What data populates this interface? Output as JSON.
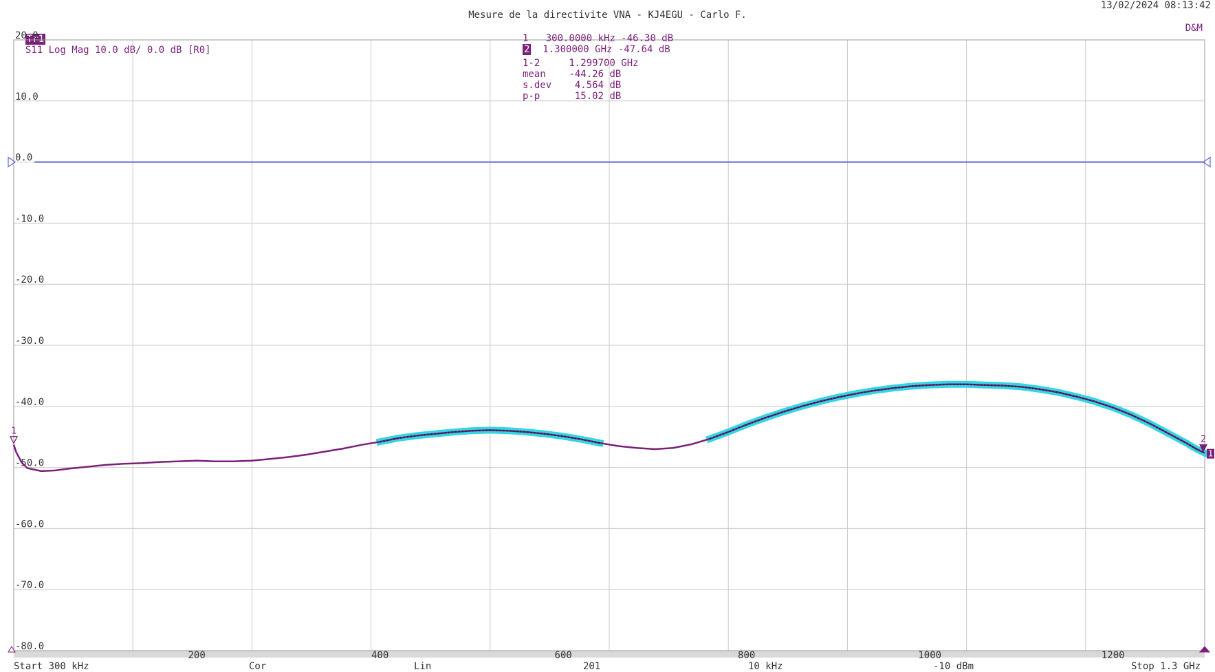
{
  "header": {
    "title": "Mesure de la directivite VNA - KJ4EGU - Carlo F.",
    "datetime": "13/02/2024 08:13:42",
    "trace_badge": "Tr1",
    "trace_info": "S11 Log Mag 10.0 dB/ 0.0 dB [R0]",
    "corner_label": "D&M"
  },
  "marker_table": {
    "m1_id": "1",
    "m1_value": "300.0000 kHz -46.30 dB",
    "m2_id": "2",
    "m2_value": "1.300000 GHz -47.64 dB",
    "delta_label": "1-2",
    "delta_value": "1.299700 GHz",
    "mean_label": "mean",
    "mean_value": "-44.26 dB",
    "sdev_label": "s.dev",
    "sdev_value": "4.564 dB",
    "pp_label": "p-p",
    "pp_value": "15.02 dB"
  },
  "footer": {
    "start": "Start 300 kHz",
    "cor": "Cor",
    "lin": "Lin",
    "points": "201",
    "ifbw": "10 kHz",
    "power": "-10 dBm",
    "stop": "Stop 1.3 GHz"
  },
  "colors": {
    "trace": "#7a1f7a",
    "highlight": "#33d6e6",
    "reference": "#5a66d9",
    "grid": "#c8c8c8",
    "bottom_bar": "#d9d9d9"
  },
  "chart_data": {
    "type": "line",
    "title": "Mesure de la directivite VNA - KJ4EGU - Carlo F.",
    "xlabel": "",
    "ylabel": "",
    "xlim": [
      0.3,
      1300
    ],
    "ylim": [
      -80,
      20
    ],
    "x_unit": "MHz",
    "y_unit": "dB",
    "yticks": [
      20,
      10,
      0,
      -10,
      -20,
      -30,
      -40,
      -50,
      -60,
      -70,
      -80
    ],
    "ytick_labels": [
      "20.0",
      "10.0",
      "0.0",
      "-10.0",
      "-20.0",
      "-30.0",
      "-40.0",
      "-50.0",
      "-60.0",
      "-70.0",
      "-80.0"
    ],
    "xticks": [
      200,
      400,
      600,
      800,
      1000,
      1200
    ],
    "xtick_labels": [
      "200",
      "400",
      "600",
      "800",
      "1000",
      "1200"
    ],
    "grid": true,
    "reference_level": 0.0,
    "series": [
      {
        "points": [
          [
            0.3,
            -46.3
          ],
          [
            3,
            -47.5
          ],
          [
            9,
            -49.2
          ],
          [
            15,
            -50.1
          ],
          [
            30,
            -50.6
          ],
          [
            45,
            -50.5
          ],
          [
            60,
            -50.2
          ],
          [
            80,
            -49.9
          ],
          [
            100,
            -49.6
          ],
          [
            120,
            -49.4
          ],
          [
            140,
            -49.3
          ],
          [
            160,
            -49.1
          ],
          [
            180,
            -49.0
          ],
          [
            200,
            -48.9
          ],
          [
            220,
            -49.0
          ],
          [
            240,
            -49.0
          ],
          [
            260,
            -48.9
          ],
          [
            280,
            -48.6
          ],
          [
            300,
            -48.3
          ],
          [
            320,
            -47.9
          ],
          [
            340,
            -47.4
          ],
          [
            360,
            -46.9
          ],
          [
            380,
            -46.3
          ],
          [
            400,
            -45.8
          ],
          [
            420,
            -45.2
          ],
          [
            440,
            -44.8
          ],
          [
            460,
            -44.5
          ],
          [
            480,
            -44.2
          ],
          [
            500,
            -44.0
          ],
          [
            520,
            -43.9
          ],
          [
            540,
            -44.0
          ],
          [
            560,
            -44.2
          ],
          [
            580,
            -44.5
          ],
          [
            600,
            -44.9
          ],
          [
            620,
            -45.4
          ],
          [
            640,
            -46.0
          ],
          [
            660,
            -46.5
          ],
          [
            680,
            -46.8
          ],
          [
            700,
            -47.0
          ],
          [
            720,
            -46.8
          ],
          [
            740,
            -46.2
          ],
          [
            760,
            -45.3
          ],
          [
            780,
            -44.2
          ],
          [
            800,
            -43.0
          ],
          [
            820,
            -41.9
          ],
          [
            840,
            -40.9
          ],
          [
            860,
            -40.0
          ],
          [
            880,
            -39.2
          ],
          [
            900,
            -38.5
          ],
          [
            920,
            -37.9
          ],
          [
            940,
            -37.4
          ],
          [
            960,
            -37.0
          ],
          [
            980,
            -36.7
          ],
          [
            1000,
            -36.5
          ],
          [
            1020,
            -36.4
          ],
          [
            1040,
            -36.4
          ],
          [
            1060,
            -36.5
          ],
          [
            1080,
            -36.6
          ],
          [
            1100,
            -36.8
          ],
          [
            1120,
            -37.2
          ],
          [
            1140,
            -37.7
          ],
          [
            1160,
            -38.4
          ],
          [
            1180,
            -39.2
          ],
          [
            1200,
            -40.2
          ],
          [
            1220,
            -41.4
          ],
          [
            1240,
            -42.8
          ],
          [
            1260,
            -44.4
          ],
          [
            1270,
            -45.2
          ],
          [
            1280,
            -46.0
          ],
          [
            1290,
            -46.9
          ],
          [
            1300,
            -47.64
          ]
        ],
        "highlight_ranges": [
          [
            388,
            640
          ],
          [
            760,
            1300
          ]
        ]
      }
    ],
    "markers": [
      {
        "id": "1",
        "x": 0.3,
        "y": -46.3
      },
      {
        "id": "2",
        "x": 1300,
        "y": -47.64
      }
    ]
  }
}
